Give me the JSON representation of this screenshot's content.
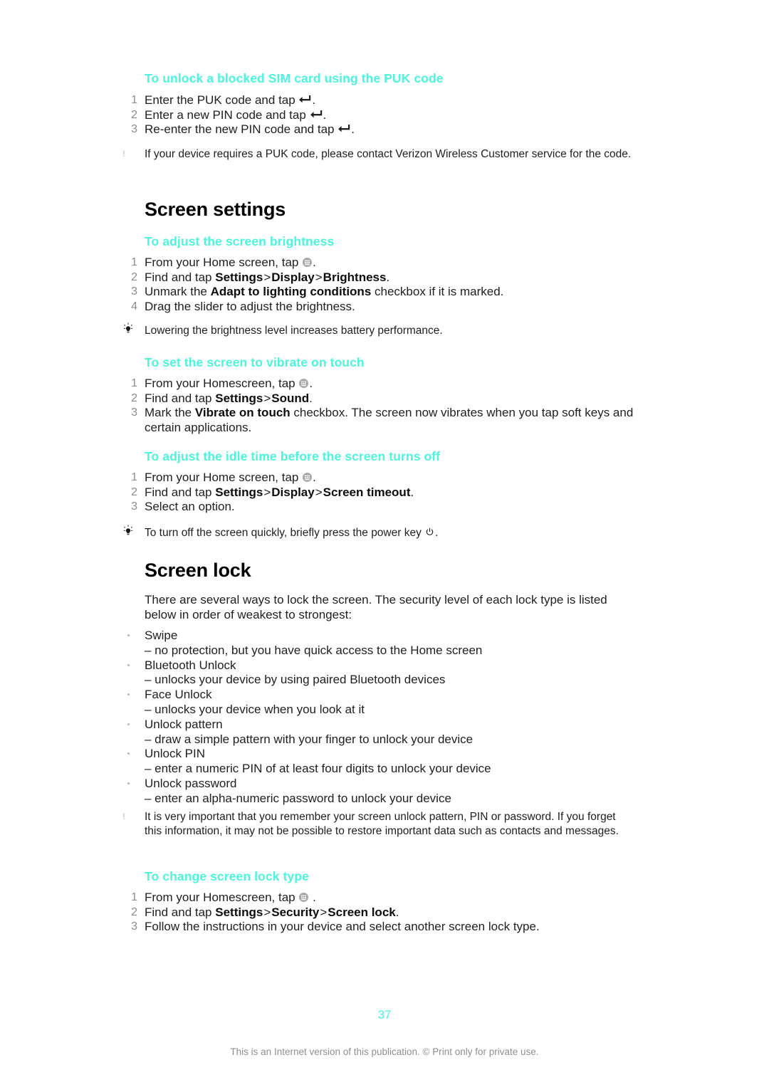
{
  "page": {
    "number": "37",
    "footer_note": "This is an Internet version of this publication. © Print only for private use.",
    "accent_color": "#4BF6DD",
    "page_number_color": "#4BF6DD"
  },
  "sections": {
    "puk": {
      "heading": "To unlock a blocked SIM card using the PUK code",
      "steps": [
        {
          "num": "1",
          "text_before": "Enter the PUK code and tap ",
          "icon": "enter-icon",
          "text_after": "."
        },
        {
          "num": "2",
          "text_before": "Enter a new PIN code and tap ",
          "icon": "enter-icon",
          "text_after": "."
        },
        {
          "num": "3",
          "text_before": "Re-enter the new PIN code and tap ",
          "icon": "enter-icon",
          "text_after": "."
        }
      ],
      "note": "If your device requires a PUK code, please contact Verizon Wireless Customer service for the code."
    },
    "screen_settings": {
      "title": "Screen settings",
      "brightness": {
        "heading": "To adjust the screen brightness",
        "steps": [
          {
            "num": "1",
            "before": "From your Home screen, tap ",
            "icon": "app-drawer-icon",
            "after": "."
          },
          {
            "num": "2",
            "before": "Find and tap ",
            "b1": "Settings",
            "sep1": ">",
            "b2": "Display",
            "sep2": ">",
            "b3": "Brightness",
            "after": "."
          },
          {
            "num": "3",
            "before": "Unmark the ",
            "b1": "Adapt to lighting conditions",
            "after": " checkbox if it is marked."
          },
          {
            "num": "4",
            "before": "Drag the slider to adjust the brightness."
          }
        ],
        "tip": "Lowering the brightness level increases battery performance."
      },
      "vibrate": {
        "heading": "To set the screen to vibrate on touch",
        "steps": [
          {
            "num": "1",
            "before": "From your Homescreen, tap ",
            "icon": "app-drawer-icon",
            "after": "."
          },
          {
            "num": "2",
            "before": "Find and tap ",
            "b1": "Settings",
            "sep1": ">",
            "b2": "Sound",
            "after": "."
          },
          {
            "num": "3",
            "before": "Mark the ",
            "b1": "Vibrate on touch",
            "after": " checkbox. The screen now vibrates when you tap soft keys and certain applications."
          }
        ]
      },
      "idle_time": {
        "heading": "To adjust the idle time before the screen turns off",
        "steps": [
          {
            "num": "1",
            "before": "From your Home screen, tap ",
            "icon": "app-drawer-icon",
            "after": "."
          },
          {
            "num": "2",
            "before": "Find and tap ",
            "b1": "Settings",
            "sep1": ">",
            "b2": "Display",
            "sep2": ">",
            "b3": "Screen timeout",
            "after": "."
          },
          {
            "num": "3",
            "before": "Select an option."
          }
        ],
        "tip_before": "To turn off the screen quickly, briefly press the power key ",
        "tip_icon": "power-icon",
        "tip_after": "."
      }
    },
    "screen_lock": {
      "title": "Screen lock",
      "intro": "There are several ways to lock the screen. The security level of each lock type is listed below in order of weakest to strongest:",
      "lock_types": [
        {
          "name": "Swipe",
          "desc": "– no protection, but you have quick access to the Home screen"
        },
        {
          "name": "Bluetooth Unlock",
          "desc": "– unlocks your device by using paired Bluetooth devices"
        },
        {
          "name": "Face Unlock",
          "desc": "– unlocks your device when you look at it"
        },
        {
          "name": "Unlock pattern",
          "desc": "– draw a simple pattern with your finger to unlock your device"
        },
        {
          "name": "Unlock PIN",
          "desc": "– enter a numeric PIN of at least four digits to unlock your device"
        },
        {
          "name": "Unlock password",
          "desc": "– enter an alpha-numeric password to unlock your device"
        }
      ],
      "note": "It is very important that you remember your screen unlock pattern, PIN or password. If you forget this information, it may not be possible to restore important data such as contacts and messages.",
      "change_lock": {
        "heading": "To change screen lock type",
        "steps": [
          {
            "num": "1",
            "before": "From your Homescreen, tap ",
            "icon": "app-drawer-icon",
            "after": " ."
          },
          {
            "num": "2",
            "before": "Find and tap ",
            "b1": "Settings",
            "sep1": ">",
            "b2": "Security",
            "sep2": ">",
            "b3": "Screen lock",
            "after": "."
          },
          {
            "num": "3",
            "before": "Follow the instructions in your device and select another screen lock type."
          }
        ]
      }
    }
  }
}
